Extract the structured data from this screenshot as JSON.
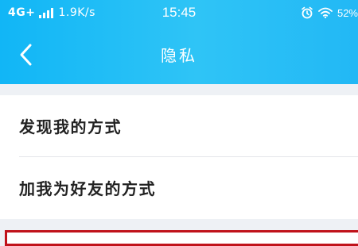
{
  "status_bar": {
    "network": "4G+",
    "speed": "1.9K/s",
    "time": "15:45",
    "battery": "52%",
    "icons": [
      "signal-icon",
      "alarm-icon",
      "wifi-icon"
    ]
  },
  "header": {
    "title": "隐私",
    "back_icon": "chevron-left-icon",
    "gradient": [
      "#11b6f6",
      "#2fc4f6"
    ]
  },
  "list": {
    "items": [
      {
        "label": "发现我的方式"
      },
      {
        "label": "加我为好友的方式"
      }
    ]
  },
  "colors": {
    "background": "#eef1f5",
    "item_text": "#222222",
    "highlight": "#c0121a"
  }
}
